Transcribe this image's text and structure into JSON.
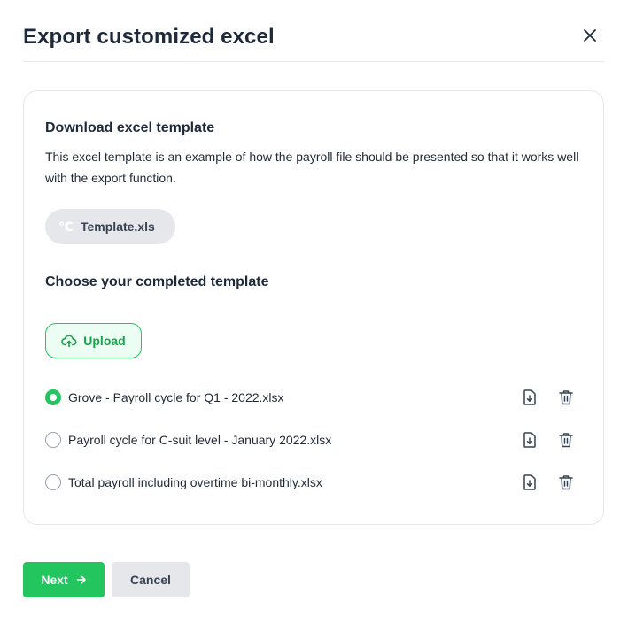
{
  "dialog": {
    "title": "Export customized excel",
    "close_icon": "close-icon"
  },
  "template_section": {
    "title": "Download excel template",
    "description": "This excel template is an example of how the payroll file should be presented so that it works well with the export function.",
    "template_button": {
      "icon_glyph": "℃",
      "label": "Template.xls"
    }
  },
  "upload_section": {
    "title": "Choose your completed template",
    "upload_button": {
      "icon": "cloud-upload-icon",
      "label": "Upload"
    }
  },
  "files": [
    {
      "name": "Grove - Payroll cycle for Q1 - 2022.xlsx",
      "selected": true
    },
    {
      "name": "Payroll cycle for C-suit level - January 2022.xlsx",
      "selected": false
    },
    {
      "name": "Total payroll including overtime bi-monthly.xlsx",
      "selected": false
    }
  ],
  "file_actions": {
    "download_icon": "file-download-icon",
    "delete_icon": "trash-icon"
  },
  "footer": {
    "next_label": "Next",
    "next_icon": "arrow-right-icon",
    "cancel_label": "Cancel"
  },
  "colors": {
    "accent": "#22c55e",
    "accent_text": "#16a34a",
    "title": "#1e2a3b",
    "muted_bg": "#e5e7eb",
    "border": "#e5e7eb"
  }
}
